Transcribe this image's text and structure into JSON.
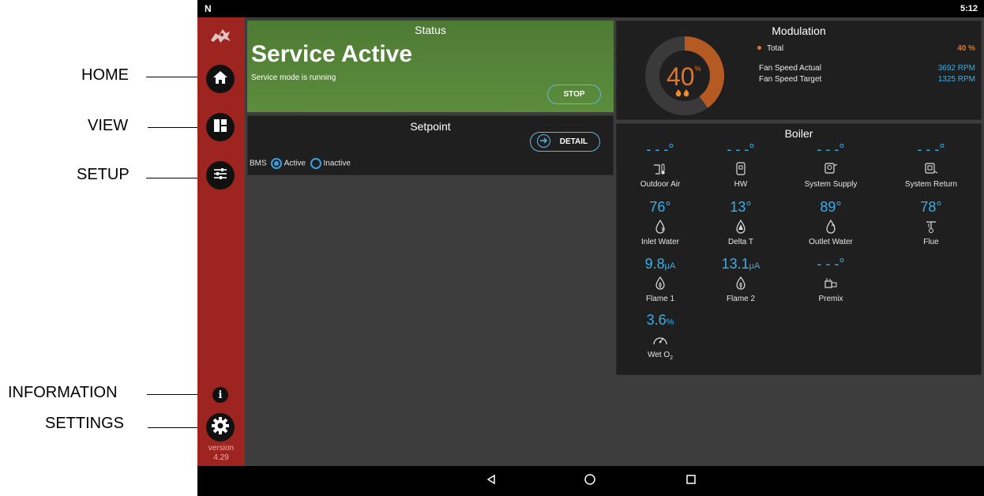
{
  "callouts": {
    "home": "HOME",
    "view": "VIEW",
    "setup": "SETUP",
    "information": "INFORMATION",
    "settings": "SETTINGS"
  },
  "statusbar": {
    "logo": "N",
    "time": "5:12"
  },
  "sidebar": {
    "version_label": "version",
    "version_number": "4.29",
    "icons": [
      "home-icon",
      "view-grid-icon",
      "setup-sliders-icon",
      "info-icon",
      "settings-gear-icon"
    ]
  },
  "status": {
    "title": "Status",
    "headline": "Service Active",
    "subtext": "Service mode is running",
    "stop_label": "STOP",
    "color": "#5a8b3c"
  },
  "setpoint": {
    "title": "Setpoint",
    "detail_label": "DETAIL",
    "bms_label": "BMS",
    "options": [
      {
        "label": "Active",
        "selected": true
      },
      {
        "label": "Inactive",
        "selected": false
      }
    ]
  },
  "modulation": {
    "title": "Modulation",
    "value": "40",
    "unit": "%",
    "percent": 40,
    "total_label": "Total",
    "total_value": "40 %",
    "rows": [
      {
        "label": "Fan Speed Actual",
        "value": "3692 RPM"
      },
      {
        "label": "Fan Speed Target",
        "value": "1325 RPM"
      }
    ],
    "accent": "#e0742a",
    "blue": "#3aaee8"
  },
  "boiler": {
    "title": "Boiler",
    "rows": [
      [
        {
          "value": "- - -°",
          "label": "Outdoor Air",
          "icon": "outdoor-air-icon"
        },
        {
          "value": "- - -°",
          "label": "HW",
          "icon": "hw-tank-icon"
        },
        {
          "value": "- - -°",
          "label": "System Supply",
          "icon": "system-supply-icon"
        },
        {
          "value": "- - -°",
          "label": "System Return",
          "icon": "system-return-icon"
        }
      ],
      [
        {
          "value": "76°",
          "label": "Inlet Water",
          "icon": "inlet-water-icon"
        },
        {
          "value": "13°",
          "label": "Delta T",
          "icon": "delta-t-icon"
        },
        {
          "value": "89°",
          "label": "Outlet Water",
          "icon": "outlet-water-icon"
        },
        {
          "value": "78°",
          "label": "Flue",
          "icon": "flue-icon"
        }
      ],
      [
        {
          "value": "9.8",
          "unit": "μA",
          "label": "Flame 1",
          "icon": "flame-1-icon"
        },
        {
          "value": "13.1",
          "unit": "μA",
          "label": "Flame 2",
          "icon": "flame-2-icon"
        },
        {
          "value": "- - -°",
          "label": "Premix",
          "icon": "premix-icon"
        }
      ],
      [
        {
          "value": "3.6",
          "unit": "%",
          "label": "Wet O",
          "sub": "2",
          "icon": "gauge-icon"
        }
      ]
    ]
  }
}
